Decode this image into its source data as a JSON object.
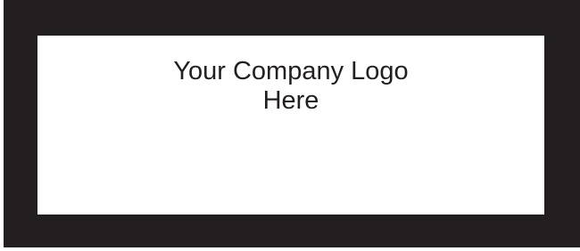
{
  "placeholder": {
    "line1": "Your Company Logo",
    "line2": "Here"
  },
  "colors": {
    "border": "#231f20",
    "panel": "#ffffff",
    "text": "#231f20"
  }
}
